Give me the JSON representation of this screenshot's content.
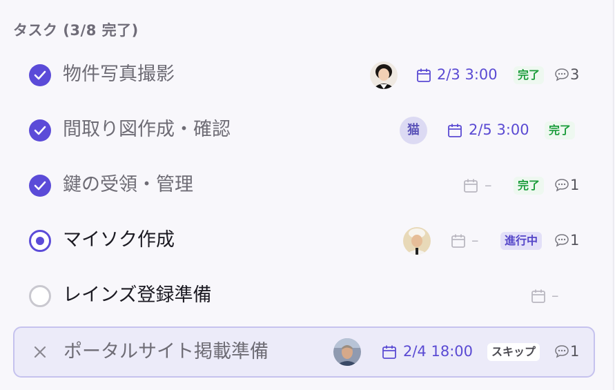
{
  "header": {
    "title": "タスク (3/8 完了)"
  },
  "tasks": [
    {
      "title": "物件写真撮影",
      "state": "done",
      "avatar": "photo-woman",
      "date": "2/3 3:00",
      "status": "完了",
      "comments": "3"
    },
    {
      "title": "間取り図作成・確認",
      "state": "done",
      "avatar_text": "猫",
      "date": "2/5 3:00",
      "status": "完了",
      "comments": ""
    },
    {
      "title": "鍵の受領・管理",
      "state": "done",
      "date": "–",
      "status": "完了",
      "comments": "1"
    },
    {
      "title": "マイソク作成",
      "state": "in-progress",
      "avatar": "photo-chef",
      "date": "–",
      "status": "進行中",
      "comments": "1"
    },
    {
      "title": "レインズ登録準備",
      "state": "todo",
      "date": "–",
      "status": "",
      "comments": ""
    },
    {
      "title": "ポータルサイト掲載準備",
      "state": "skipped",
      "avatar": "photo-man",
      "date": "2/4 18:00",
      "status": "スキップ",
      "comments": "1"
    }
  ],
  "colors": {
    "accent": "#5b4bd8",
    "done_text": "#1a9c3a",
    "skip_row_bg": "#ecebf9"
  }
}
